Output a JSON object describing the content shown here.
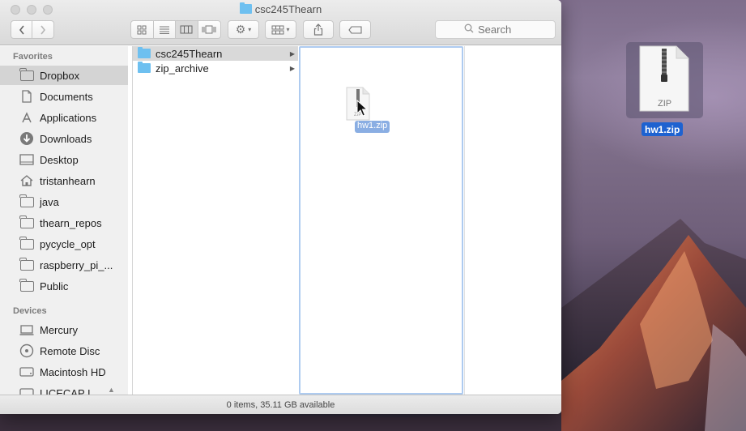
{
  "window": {
    "title": "csc245Thearn",
    "search_placeholder": "Search",
    "status": "0 items, 35.11 GB available"
  },
  "sidebar": {
    "favorites_header": "Favorites",
    "favorites": [
      {
        "label": "Dropbox",
        "icon": "dropbox-folder-icon",
        "selected": true
      },
      {
        "label": "Documents",
        "icon": "documents-icon"
      },
      {
        "label": "Applications",
        "icon": "applications-icon"
      },
      {
        "label": "Downloads",
        "icon": "downloads-icon"
      },
      {
        "label": "Desktop",
        "icon": "desktop-icon"
      },
      {
        "label": "tristanhearn",
        "icon": "home-icon"
      },
      {
        "label": "java",
        "icon": "folder-icon"
      },
      {
        "label": "thearn_repos",
        "icon": "folder-icon"
      },
      {
        "label": "pycycle_opt",
        "icon": "folder-icon"
      },
      {
        "label": "raspberry_pi_...",
        "icon": "folder-icon"
      },
      {
        "label": "Public",
        "icon": "folder-icon"
      }
    ],
    "devices_header": "Devices",
    "devices": [
      {
        "label": "Mercury",
        "icon": "computer-icon"
      },
      {
        "label": "Remote Disc",
        "icon": "disc-icon"
      },
      {
        "label": "Macintosh HD",
        "icon": "hard-drive-icon"
      },
      {
        "label": "LICECAP I...",
        "icon": "disk-image-icon"
      }
    ]
  },
  "column1": {
    "items": [
      {
        "label": "csc245Thearn",
        "selected": true
      },
      {
        "label": "zip_archive",
        "selected": false
      }
    ]
  },
  "drag": {
    "file_label": "hw1.zip",
    "doc_text": "ZIP"
  },
  "desktop": {
    "file_label": "hw1.zip",
    "doc_text": "ZIP"
  }
}
